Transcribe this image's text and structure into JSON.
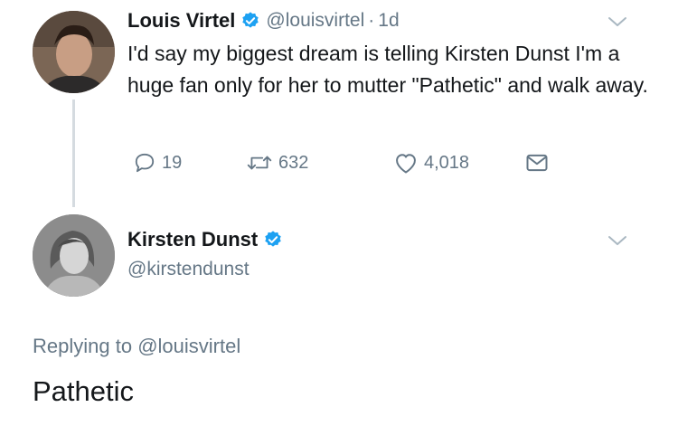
{
  "colors": {
    "text_primary": "#14171a",
    "text_secondary": "#657786",
    "verified_blue": "#1da1f2",
    "thread_line": "#d5dbe0"
  },
  "tweet": {
    "author_name": "Louis Virtel",
    "verified_icon": "verified-badge-icon",
    "handle": "@louisvirtel",
    "separator": "·",
    "time": "1d",
    "text": "I'd say my biggest dream is telling Kirsten Dunst I'm a huge fan only for her to mutter \"Pathetic\" and walk away.",
    "actions": {
      "reply_icon": "reply-icon",
      "reply_count": "19",
      "retweet_icon": "retweet-icon",
      "retweet_count": "632",
      "like_icon": "heart-icon",
      "like_count": "4,018",
      "dm_icon": "envelope-icon"
    },
    "menu_icon": "chevron-down-icon"
  },
  "reply": {
    "author_name": "Kirsten Dunst",
    "verified_icon": "verified-badge-icon",
    "handle": "@kirstendunst",
    "replying_prefix": "Replying to",
    "replying_to": "@louisvirtel",
    "text": "Pathetic",
    "menu_icon": "chevron-down-icon"
  }
}
